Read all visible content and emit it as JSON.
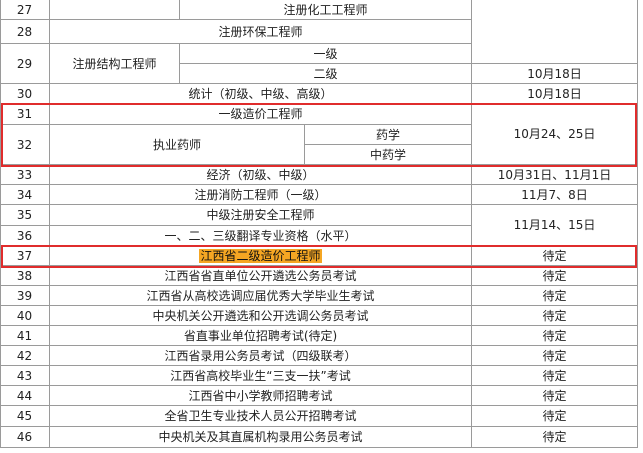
{
  "rows": [
    {
      "num": "27",
      "name": "注册化工工程师"
    },
    {
      "num": "28",
      "name": "注册环保工程师"
    },
    {
      "num": "29",
      "name": "注册结构工程师",
      "sub1": "一级",
      "sub2": "二级"
    },
    {
      "num": "30",
      "name": "统计（初级、中级、高级）",
      "date": "10月18日",
      "date29": "10月18日"
    },
    {
      "num": "31",
      "name": "一级造价工程师",
      "date": "10月24、25日"
    },
    {
      "num": "32",
      "name": "执业药师",
      "sub1": "药学",
      "sub2": "中药学"
    },
    {
      "num": "33",
      "name": "经济（初级、中级）",
      "date": "10月31日、11月1日"
    },
    {
      "num": "34",
      "name": "注册消防工程师（一级）",
      "date": "11月7、8日"
    },
    {
      "num": "35",
      "name": "中级注册安全工程师",
      "date": "11月14、15日"
    },
    {
      "num": "36",
      "name": "一、二、三级翻译专业资格（水平）"
    },
    {
      "num": "37",
      "name": "江西省二级造价工程师",
      "date": "待定"
    },
    {
      "num": "38",
      "name": "江西省省直单位公开遴选公务员考试",
      "date": "待定"
    },
    {
      "num": "39",
      "name": "江西省从高校选调应届优秀大学毕业生考试",
      "date": "待定"
    },
    {
      "num": "40",
      "name": "中央机关公开遴选和公开选调公务员考试",
      "date": "待定"
    },
    {
      "num": "41",
      "name": "省直事业单位招聘考试(待定)",
      "date": "待定"
    },
    {
      "num": "42",
      "name": "江西省录用公务员考试（四级联考）",
      "date": "待定"
    },
    {
      "num": "43",
      "name": "江西省高校毕业生“三支一扶”考试",
      "date": "待定"
    },
    {
      "num": "44",
      "name": "江西省中小学教师招聘考试",
      "date": "待定"
    },
    {
      "num": "45",
      "name": "全省卫生专业技术人员公开招聘考试",
      "date": "待定"
    },
    {
      "num": "46",
      "name": "中央机关及其直属机构录用公务员考试",
      "date": "待定"
    }
  ],
  "colors": {
    "border": "#9a9a9a",
    "highlight_box": "#e02c2c",
    "text_highlight": "#f5a623"
  }
}
